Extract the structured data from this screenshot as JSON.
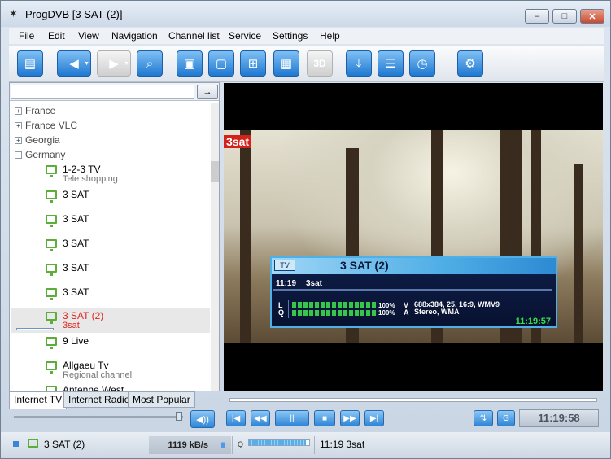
{
  "window": {
    "title": "ProgDVB [3 SAT (2)]",
    "controls": {
      "minimize": "–",
      "maximize": "□",
      "close": "✕"
    }
  },
  "menu": [
    "File",
    "Edit",
    "View",
    "Navigation",
    "Channel list",
    "Service",
    "Settings",
    "Help"
  ],
  "toolbar": {
    "buttons": [
      {
        "name": "open-folder",
        "glyph": "▤"
      },
      {
        "name": "back",
        "glyph": "◀"
      },
      {
        "name": "forward",
        "glyph": "▶"
      },
      {
        "name": "search",
        "glyph": "⌕"
      },
      {
        "name": "window-mode",
        "glyph": "▣"
      },
      {
        "name": "window-mode-2",
        "glyph": "▢"
      },
      {
        "name": "grid-4",
        "glyph": "⊞"
      },
      {
        "name": "grid-16",
        "glyph": "▦"
      },
      {
        "name": "3d",
        "glyph": "3D"
      },
      {
        "name": "record",
        "glyph": "⤓"
      },
      {
        "name": "epg-list",
        "glyph": "☰"
      },
      {
        "name": "scheduler",
        "glyph": "◷"
      },
      {
        "name": "settings",
        "glyph": "⚙"
      }
    ]
  },
  "sidebar": {
    "search": {
      "value": "",
      "placeholder": "",
      "go_glyph": "→"
    },
    "groups": [
      {
        "label": "France",
        "expander": "+"
      },
      {
        "label": "France VLC",
        "expander": "+"
      },
      {
        "label": "Georgia",
        "expander": "+"
      },
      {
        "label": "Germany",
        "expander": "−"
      }
    ],
    "channels": [
      {
        "name": "1-2-3 TV",
        "sub": "Tele shopping"
      },
      {
        "name": "3 SAT",
        "sub": ""
      },
      {
        "name": "3 SAT",
        "sub": ""
      },
      {
        "name": "3 SAT",
        "sub": ""
      },
      {
        "name": "3 SAT",
        "sub": ""
      },
      {
        "name": "3 SAT",
        "sub": ""
      },
      {
        "name": "3 SAT (2)",
        "sub": "3sat",
        "selected": true
      },
      {
        "name": "9 Live",
        "sub": ""
      },
      {
        "name": "Allgaeu Tv",
        "sub": "Regional channel"
      },
      {
        "name": "Antenne West",
        "sub": ""
      }
    ],
    "tabs": [
      "Internet TV",
      "Internet Radio",
      "Most Popular"
    ],
    "active_tab": "Internet TV",
    "volume_percent": 100,
    "mute_glyph": "◀))"
  },
  "video": {
    "logo": "3sat",
    "osd": {
      "tv_badge": "TV",
      "title": "3 SAT (2)",
      "time": "11:19",
      "program": "3sat",
      "l_label": "L",
      "q_label": "Q",
      "level_percent": "100%",
      "quality_percent": "100%",
      "v_label": "V",
      "a_label": "A",
      "video_info": "688x384, 25, 16:9, WMV9",
      "audio_info": "Stereo, WMA",
      "clock": "11:19:57"
    }
  },
  "playback": {
    "buttons": [
      {
        "name": "previous",
        "glyph": "|◀"
      },
      {
        "name": "rewind",
        "glyph": "◀◀"
      },
      {
        "name": "pause",
        "glyph": "||"
      },
      {
        "name": "stop",
        "glyph": "■"
      },
      {
        "name": "fast-forward",
        "glyph": "▶▶"
      },
      {
        "name": "next",
        "glyph": "▶|"
      }
    ],
    "equalizer_glyph": "⇅",
    "refresh_glyph": "G",
    "clock": "11:19:58",
    "seek_percent": 0
  },
  "statusbar": {
    "channel": "3 SAT (2)",
    "bitrate": "1119 kB/s",
    "q_label": "Q",
    "quality_percent": 95,
    "program": "11:19 3sat"
  }
}
